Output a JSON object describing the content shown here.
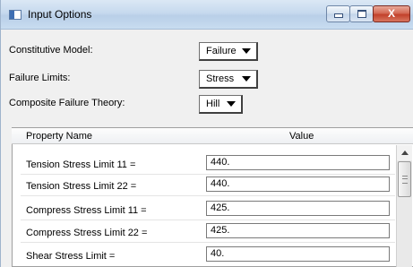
{
  "window": {
    "title": "Input Options",
    "close_glyph": "X"
  },
  "options": {
    "constitutive_model": {
      "label": "Constitutive Model:",
      "value": "Failure"
    },
    "failure_limits": {
      "label": "Failure Limits:",
      "value": "Stress"
    },
    "composite_failure_theory": {
      "label": "Composite Failure Theory:",
      "value": "Hill"
    }
  },
  "table": {
    "headers": {
      "name": "Property Name",
      "value": "Value"
    },
    "rows": [
      {
        "name": "Tension Stress Limit 11 =",
        "value": "440."
      },
      {
        "name": "Tension Stress Limit 22 =",
        "value": "440."
      },
      {
        "name": "Compress Stress Limit 11 =",
        "value": "425."
      },
      {
        "name": "Compress Stress Limit 22 =",
        "value": "425."
      },
      {
        "name": "Shear Stress Limit =",
        "value": "40."
      }
    ]
  }
}
